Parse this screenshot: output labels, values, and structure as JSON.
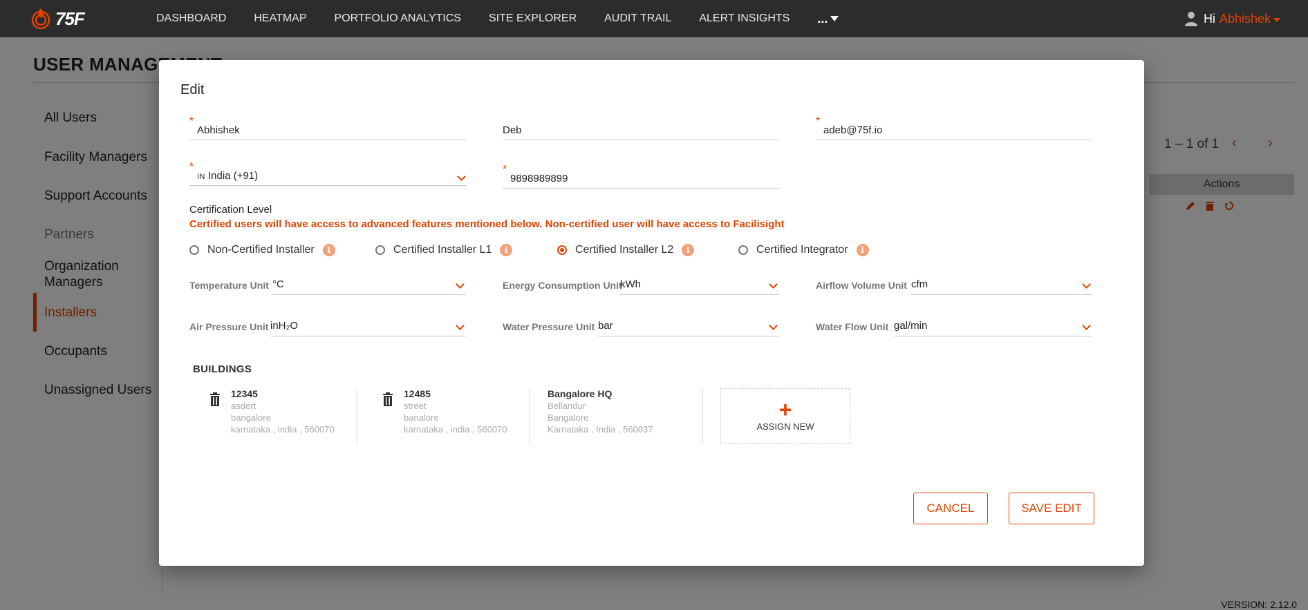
{
  "app": {
    "logo_text": "75F"
  },
  "nav": {
    "items": [
      "DASHBOARD",
      "HEATMAP",
      "PORTFOLIO ANALYTICS",
      "SITE EXPLORER",
      "AUDIT TRAIL",
      "ALERT INSIGHTS"
    ],
    "more_label": "..."
  },
  "user": {
    "greeting": "Hi",
    "name": "Abhishek"
  },
  "page": {
    "title": "USER MANAGEMENT"
  },
  "sidebar": {
    "items": [
      "All Users",
      "Facility Managers",
      "Support Accounts",
      "Partners",
      "Organization Managers",
      "Installers",
      "Occupants",
      "Unassigned Users"
    ],
    "active": "Installers"
  },
  "table": {
    "pagination": "1 – 1 of 1",
    "actions_header": "Actions"
  },
  "version": "VERSION: 2.12.0",
  "modal": {
    "title": "Edit",
    "first_name": "Abhishek",
    "last_name": "Deb",
    "email": "adeb@75f.io",
    "country_flag": "IN",
    "country": "India (+91)",
    "phone": "9898989899",
    "required_marker": "*",
    "certification": {
      "title": "Certification Level",
      "note": "Certified users will have access to advanced features mentioned below. Non-certified user will have access to Facilisight",
      "options": [
        "Non-Certified Installer",
        "Certified Installer L1",
        "Certified Installer L2",
        "Certified Integrator"
      ],
      "selected": "Certified Installer L2",
      "info_glyph": "i"
    },
    "units": {
      "temperature": {
        "label": "Temperature Unit",
        "value": "°C"
      },
      "energy": {
        "label": "Energy Consumption Unit",
        "value": "kWh"
      },
      "airflow": {
        "label": "Airflow Volume Unit",
        "value": "cfm"
      },
      "air_pressure": {
        "label": "Air Pressure Unit",
        "value": "inH₂O"
      },
      "water_pressure": {
        "label": "Water Pressure Unit",
        "value": "bar"
      },
      "water_flow": {
        "label": "Water Flow Unit",
        "value": "gal/min"
      }
    },
    "buildings": {
      "title": "BUILDINGS",
      "items": [
        {
          "name": "12345",
          "line1": "asdert",
          "line2": "bangalore",
          "line3": "karnataka , india , 560070"
        },
        {
          "name": "12485",
          "line1": "street",
          "line2": "banalore",
          "line3": "karnataka , india , 560070"
        },
        {
          "name": "Bangalore HQ",
          "line1": "Bellandur",
          "line2": "Bangalore",
          "line3": "Karnataka , India , 560037"
        }
      ],
      "assign_plus": "+",
      "assign_label": "ASSIGN NEW"
    },
    "cancel_label": "CANCEL",
    "save_label": "SAVE EDIT"
  },
  "colors": {
    "accent": "#e24301",
    "topbar": "#2c2c2c"
  }
}
